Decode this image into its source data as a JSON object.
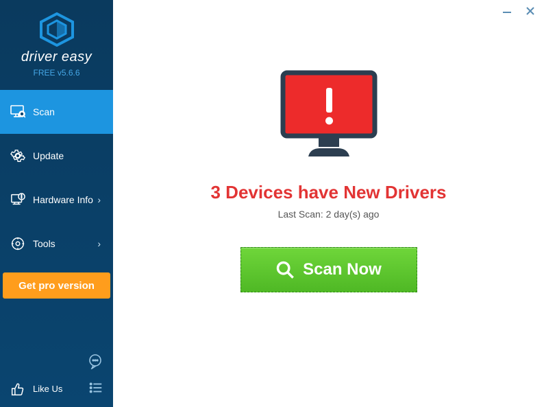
{
  "app": {
    "name": "driver easy",
    "version": "FREE v5.6.6"
  },
  "sidebar": {
    "items": [
      {
        "label": "Scan",
        "has_chevron": false,
        "active": true
      },
      {
        "label": "Update",
        "has_chevron": false,
        "active": false
      },
      {
        "label": "Hardware Info",
        "has_chevron": true,
        "active": false
      },
      {
        "label": "Tools",
        "has_chevron": true,
        "active": false
      }
    ],
    "pro_button": "Get pro version",
    "like_label": "Like Us"
  },
  "main": {
    "headline": "3 Devices have New Drivers",
    "last_scan": "Last Scan: 2 day(s) ago",
    "scan_button": "Scan Now"
  },
  "colors": {
    "accent": "#1d95e0",
    "warning": "#e23434",
    "action": "#5ac02c",
    "pro": "#ff9d1c"
  }
}
